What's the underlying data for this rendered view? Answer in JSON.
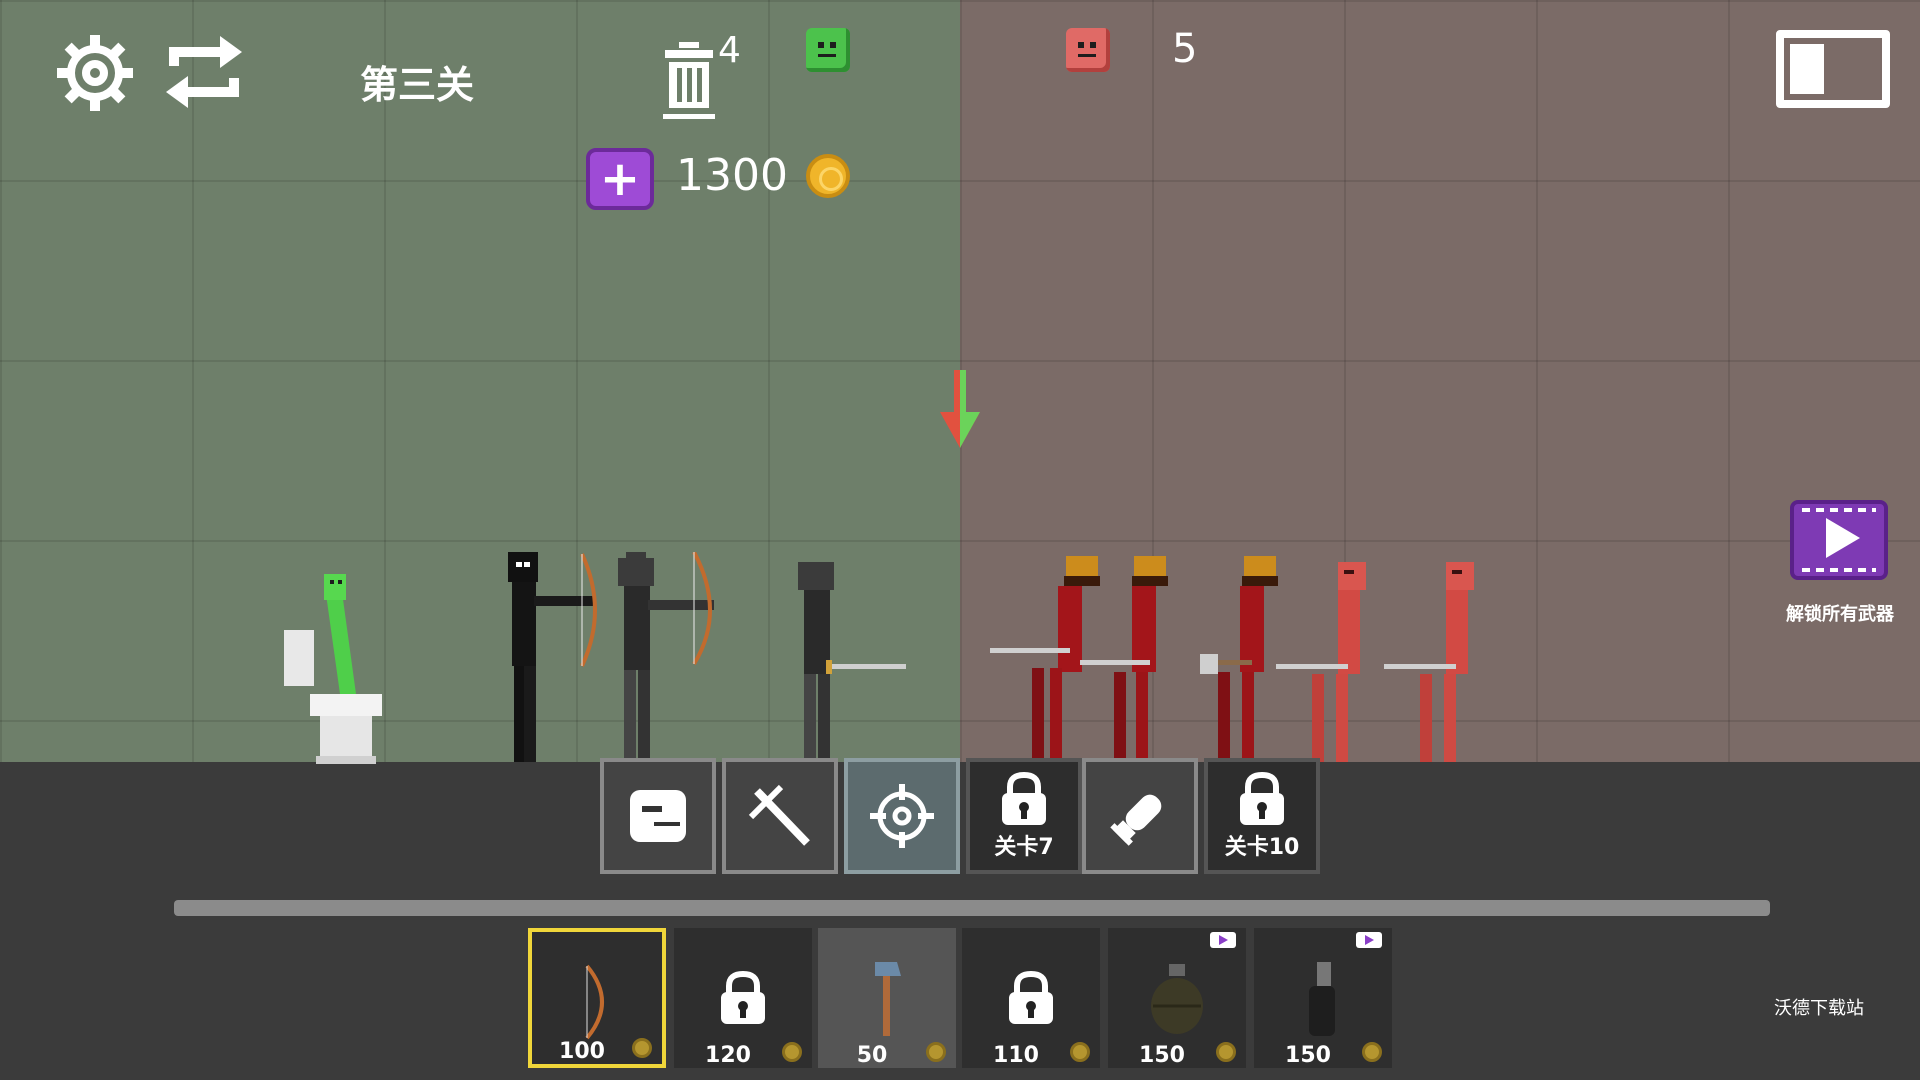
{
  "hud": {
    "level_title": "第三关",
    "trash_count": "4",
    "enemy_count": "5",
    "coins": "1300",
    "add_coins_symbol": "+"
  },
  "side": {
    "video_label": "解锁所有武器"
  },
  "tabs": [
    {
      "name": "characters",
      "label": "",
      "state": "normal"
    },
    {
      "name": "melee",
      "label": "",
      "state": "normal"
    },
    {
      "name": "ranged",
      "label": "",
      "state": "active"
    },
    {
      "name": "locked-7",
      "label": "关卡7",
      "state": "locked"
    },
    {
      "name": "explosives",
      "label": "",
      "state": "normal"
    },
    {
      "name": "locked-10",
      "label": "关卡10",
      "state": "locked"
    }
  ],
  "items": [
    {
      "name": "bow",
      "price": "100",
      "selected": true,
      "locked": false,
      "video": false
    },
    {
      "name": "locked-item",
      "price": "120",
      "selected": false,
      "locked": true,
      "video": false
    },
    {
      "name": "axe",
      "price": "50",
      "selected": false,
      "locked": false,
      "video": false
    },
    {
      "name": "locked-item",
      "price": "110",
      "selected": false,
      "locked": true,
      "video": false
    },
    {
      "name": "grenade",
      "price": "150",
      "selected": false,
      "locked": false,
      "video": true
    },
    {
      "name": "molotov",
      "price": "150",
      "selected": false,
      "locked": false,
      "video": true
    }
  ],
  "colors": {
    "player_zone": "#6e7f6a",
    "enemy_zone": "#7b6b67",
    "selected_slot": "#f0d63a",
    "coin": "#f0b52a",
    "purple": "#9e4bd6"
  },
  "watermark": "沃德下载站"
}
